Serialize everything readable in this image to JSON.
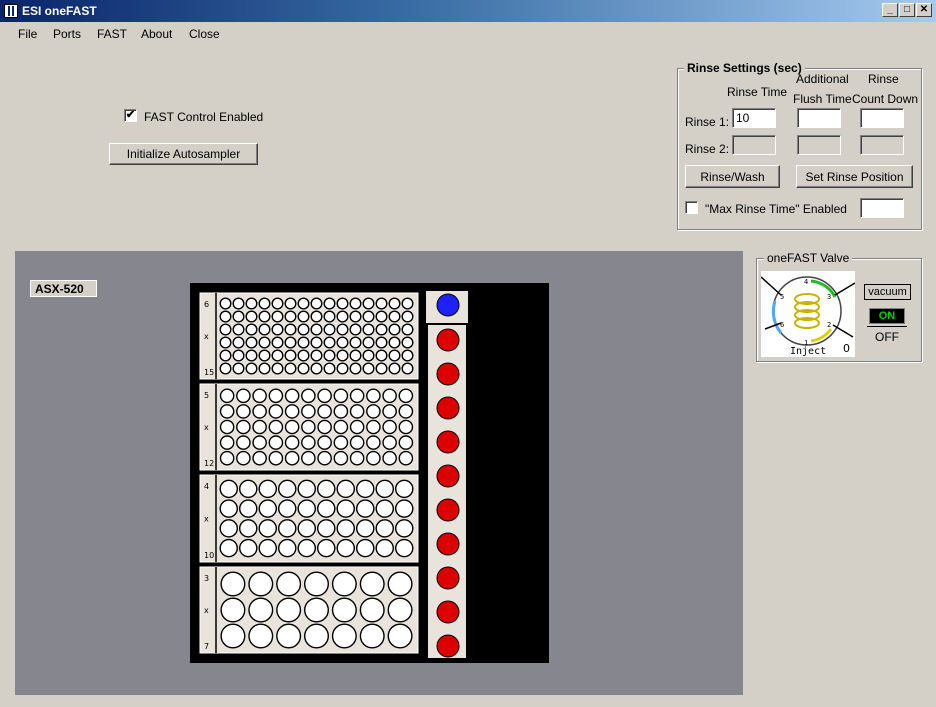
{
  "window": {
    "title": "ESI oneFAST"
  },
  "menu": [
    "File",
    "Ports",
    "FAST",
    "About",
    "Close"
  ],
  "controls": {
    "fast_control_label": "FAST Control Enabled",
    "fast_control_checked": true,
    "initialize_button": "Initialize Autosampler"
  },
  "rinse": {
    "title": "Rinse Settings (sec)",
    "col_rinse_time": "Rinse Time",
    "col_flush_line1": "Additional",
    "col_flush_line2": "Flush Time",
    "col_count_line1": "Rinse",
    "col_count_line2": "Count Down",
    "rinse1_label": "Rinse 1:",
    "rinse1_time": "10",
    "rinse2_label": "Rinse 2:",
    "rinse_wash_button": "Rinse/Wash",
    "set_position_button": "Set Rinse Position",
    "max_rinse_label": "\"Max Rinse Time\" Enabled",
    "max_rinse_checked": false
  },
  "tray": {
    "label": "ASX-520",
    "racks": [
      {
        "rows_label": "6",
        "x_label": "x",
        "cols_label": "15",
        "rows": 6,
        "cols": 15
      },
      {
        "rows_label": "5",
        "x_label": "x",
        "cols_label": "12",
        "rows": 5,
        "cols": 12
      },
      {
        "rows_label": "4",
        "x_label": "x",
        "cols_label": "10",
        "rows": 4,
        "cols": 10
      },
      {
        "rows_label": "3",
        "x_label": "x",
        "cols_label": "7",
        "rows": 3,
        "cols": 7
      }
    ],
    "standard_count": 10,
    "rinse_position_color": "#2020ff",
    "standard_color": "#dd0000"
  },
  "valve": {
    "title": "oneFAST Valve",
    "vacuum_label": "vacuum",
    "on_label": "ON",
    "off_label": "OFF",
    "on_color": "#00cc00",
    "inject_label": "Inject",
    "inject_count": "0",
    "port_labels": [
      "1",
      "2",
      "3",
      "4",
      "5",
      "6"
    ]
  }
}
